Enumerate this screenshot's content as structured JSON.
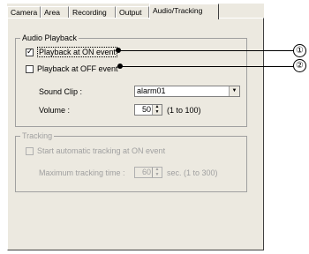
{
  "tabs": [
    {
      "label": "Camera",
      "active": false
    },
    {
      "label": "Area",
      "active": false
    },
    {
      "label": "Recording",
      "active": false
    },
    {
      "label": "Output",
      "active": false
    },
    {
      "label": "Audio/Tracking",
      "active": true
    }
  ],
  "audio_playback": {
    "title": "Audio Playback",
    "on_event": {
      "label": "Playback at ON event",
      "checked": true
    },
    "off_event": {
      "label": "Playback at OFF event",
      "checked": false
    },
    "sound_clip": {
      "label": "Sound Clip :",
      "value": "alarm01"
    },
    "volume": {
      "label": "Volume :",
      "value": "50",
      "range": "(1 to 100)"
    }
  },
  "tracking": {
    "title": "Tracking",
    "auto_tracking": {
      "label": "Start automatic tracking at ON event",
      "checked": false
    },
    "max_time": {
      "label": "Maximum tracking time :",
      "value": "60",
      "unit": "sec. (1 to 300)"
    }
  },
  "callouts": [
    "①",
    "②"
  ]
}
